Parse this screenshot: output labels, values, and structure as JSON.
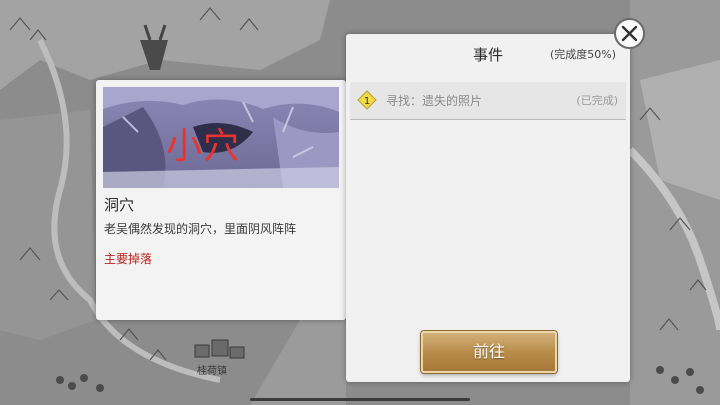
{
  "location": {
    "image_caption": "小穴",
    "name": "洞穴",
    "description": "老吴偶然发现的洞穴，里面阴风阵阵",
    "drops_label": "主要掉落"
  },
  "event": {
    "title": "事件",
    "progress": "(完成度50%)",
    "tasks": [
      {
        "index": "1",
        "text": "寻找：遗失的照片",
        "status": "(已完成)"
      }
    ],
    "go_button": "前往"
  },
  "map": {
    "town_label": "桂荷镇"
  },
  "colors": {
    "caption_red": "#e8332e",
    "drops_red": "#b4241f",
    "button_gold": "#b68a47",
    "badge_yellow": "#f2d94a"
  },
  "icons": {
    "close": "close-icon",
    "task_badge": "diamond-number-icon"
  }
}
